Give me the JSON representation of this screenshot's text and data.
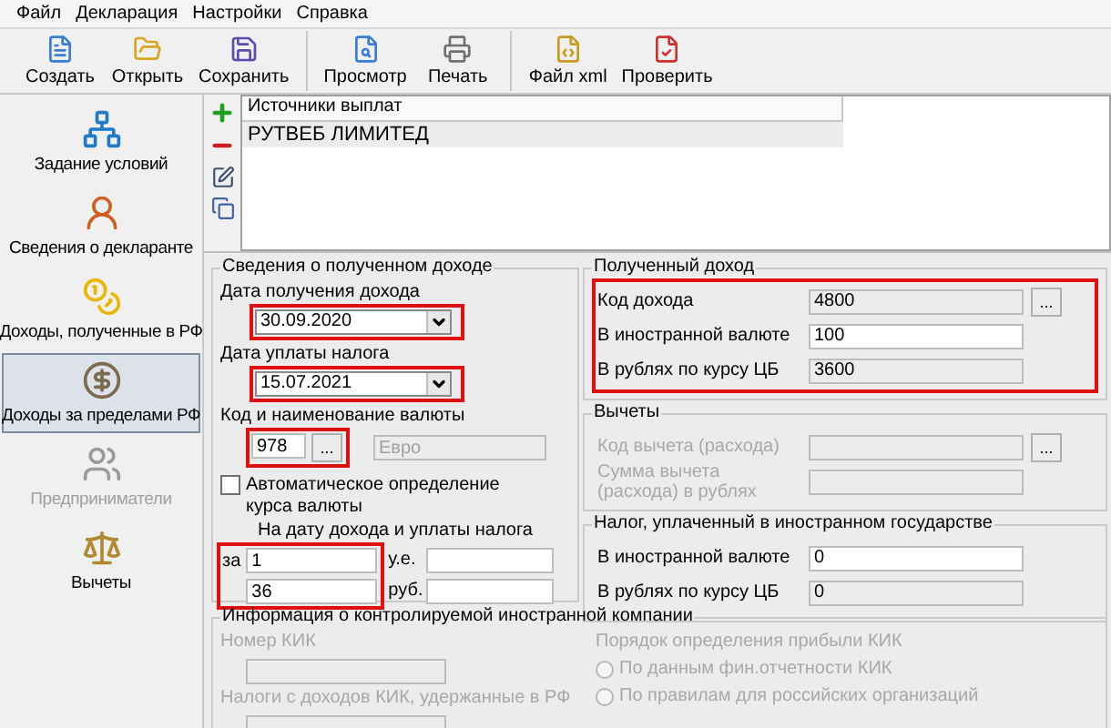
{
  "menu": [
    "Файл",
    "Декларация",
    "Настройки",
    "Справка"
  ],
  "toolbar": [
    [
      {
        "label": "Создать",
        "kind": "new"
      },
      {
        "label": "Открыть",
        "kind": "open"
      },
      {
        "label": "Сохранить",
        "kind": "save"
      }
    ],
    [
      {
        "label": "Просмотр",
        "kind": "preview"
      },
      {
        "label": "Печать",
        "kind": "print"
      }
    ],
    [
      {
        "label": "Файл xml",
        "kind": "xml"
      },
      {
        "label": "Проверить",
        "kind": "check"
      }
    ]
  ],
  "sidebar": {
    "items": [
      {
        "label": "Задание условий",
        "kind": "conditions",
        "selected": false,
        "disabled": false
      },
      {
        "label": "Сведения о декларанте",
        "kind": "declarant",
        "selected": false,
        "disabled": false
      },
      {
        "label": "Доходы, полученные в РФ",
        "kind": "income_rf",
        "selected": false,
        "disabled": false
      },
      {
        "label": "Доходы за пределами РФ",
        "kind": "income_abroad",
        "selected": true,
        "disabled": false
      },
      {
        "label": "Предприниматели",
        "kind": "business",
        "selected": false,
        "disabled": true
      },
      {
        "label": "Вычеты",
        "kind": "deductions",
        "selected": false,
        "disabled": false
      }
    ]
  },
  "sources": {
    "column": "Источники выплат",
    "rows": [
      "РУТВЕБ ЛИМИТЕД"
    ]
  },
  "income_info": {
    "title": "Сведения о полученном доходе",
    "date_received": {
      "label": "Дата получения дохода",
      "value": "30.09.2020",
      "highlighted": true
    },
    "tax_date": {
      "label": "Дата уплаты налога",
      "value": "15.07.2021",
      "highlighted": true
    },
    "currency": {
      "label": "Код и наименование валюты",
      "code": "978",
      "button": "...",
      "name": "Евро",
      "highlighted": true
    },
    "auto_rate": {
      "label": "Автоматическое определение курса валюты",
      "checked": false
    },
    "rate": {
      "caption": "На дату дохода и уплаты налога",
      "for_label": "за",
      "units": "1",
      "rubles": "36",
      "unit_label": "у.е.",
      "rub_label": "руб.",
      "highlighted": true
    }
  },
  "received": {
    "title": "Полученный доход",
    "highlighted": true,
    "rows": [
      {
        "label": "Код дохода",
        "value": "4800",
        "kind": "readonly",
        "button": "..."
      },
      {
        "label": "В иностранной валюте",
        "value": "100",
        "kind": "editable"
      },
      {
        "label": "В рублях по курсу ЦБ",
        "value": "3600",
        "kind": "readonly"
      }
    ]
  },
  "deductions": {
    "title": "Вычеты",
    "highlighted": false,
    "rows": [
      {
        "label": "Код вычета (расхода)",
        "kind": "disabled",
        "button": "..."
      },
      {
        "label": "Сумма вычета (расхода) в рублях",
        "kind": "disabled"
      }
    ]
  },
  "foreign_tax": {
    "title": "Налог, уплаченный в иностранном государстве",
    "highlighted": false,
    "rows": [
      {
        "label": "В иностранной валюте",
        "value": "0",
        "kind": "editable"
      },
      {
        "label": "В рублях по курсу ЦБ",
        "value": "0",
        "kind": "readonly"
      }
    ]
  },
  "cfc": {
    "title": "Информация о контролируемой иностранной компании",
    "disabled": true,
    "fields": [
      {
        "label": "Номер КИК"
      },
      {
        "label": "Налоги с доходов КИК, удержанные в РФ"
      }
    ],
    "method": {
      "label": "Порядок определения прибыли КИК",
      "options": [
        {
          "label": "По данным фин.отчетности КИК",
          "selected": false
        },
        {
          "label": "По правилам для российских организаций",
          "selected": false
        }
      ]
    }
  }
}
